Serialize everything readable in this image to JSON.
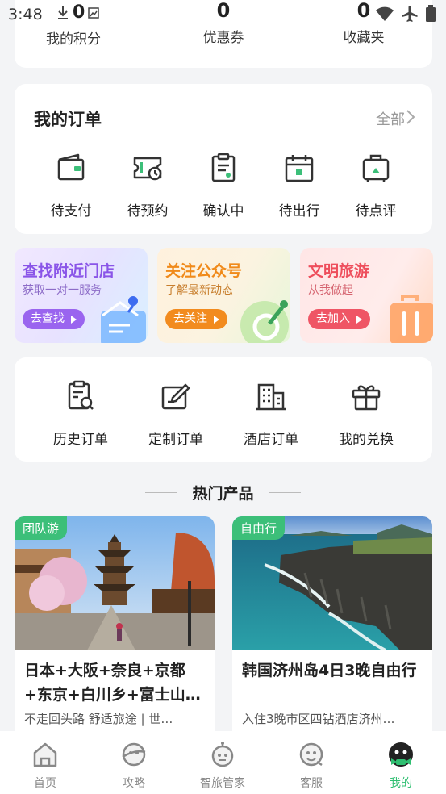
{
  "status_bar": {
    "time": "3:48",
    "notif_count": "0"
  },
  "stats": [
    {
      "value": "0",
      "label": "我的积分"
    },
    {
      "value": "0",
      "label": "优惠券"
    },
    {
      "value": "0",
      "label": "收藏夹"
    }
  ],
  "orders": {
    "title": "我的订单",
    "all_label": "全部",
    "items": [
      {
        "label": "待支付",
        "icon": "wallet-icon"
      },
      {
        "label": "待预约",
        "icon": "ticket-clock-icon"
      },
      {
        "label": "确认中",
        "icon": "clipboard-icon"
      },
      {
        "label": "待出行",
        "icon": "calendar-icon"
      },
      {
        "label": "待点评",
        "icon": "luggage-icon"
      }
    ]
  },
  "promos": [
    {
      "title": "查找附近门店",
      "subtitle": "获取一对一服务",
      "button": "去查找"
    },
    {
      "title": "关注公众号",
      "subtitle": "了解最新动态",
      "button": "去关注"
    },
    {
      "title": "文明旅游",
      "subtitle": "从我做起",
      "button": "去加入"
    }
  ],
  "services": [
    {
      "label": "历史订单",
      "icon": "history-order-icon"
    },
    {
      "label": "定制订单",
      "icon": "custom-order-icon"
    },
    {
      "label": "酒店订单",
      "icon": "hotel-icon"
    },
    {
      "label": "我的兑换",
      "icon": "gift-icon"
    }
  ],
  "hot": {
    "title": "热门产品",
    "products": [
      {
        "tag": "团队游",
        "name": "日本+大阪+奈良+京都+东京+白川乡+富士山…",
        "desc": "不走回头路 舒适旅途 | 世…"
      },
      {
        "tag": "自由行",
        "name": "韩国济州岛4日3晚自由行",
        "desc": "入住3晚市区四钻酒店济州…"
      }
    ]
  },
  "tabbar": {
    "items": [
      {
        "label": "首页",
        "icon": "home-icon"
      },
      {
        "label": "攻略",
        "icon": "guide-icon"
      },
      {
        "label": "智旅管家",
        "icon": "assistant-icon"
      },
      {
        "label": "客服",
        "icon": "service-icon"
      },
      {
        "label": "我的",
        "icon": "profile-icon"
      }
    ],
    "active": "我的",
    "accent": "#2fbf71"
  }
}
